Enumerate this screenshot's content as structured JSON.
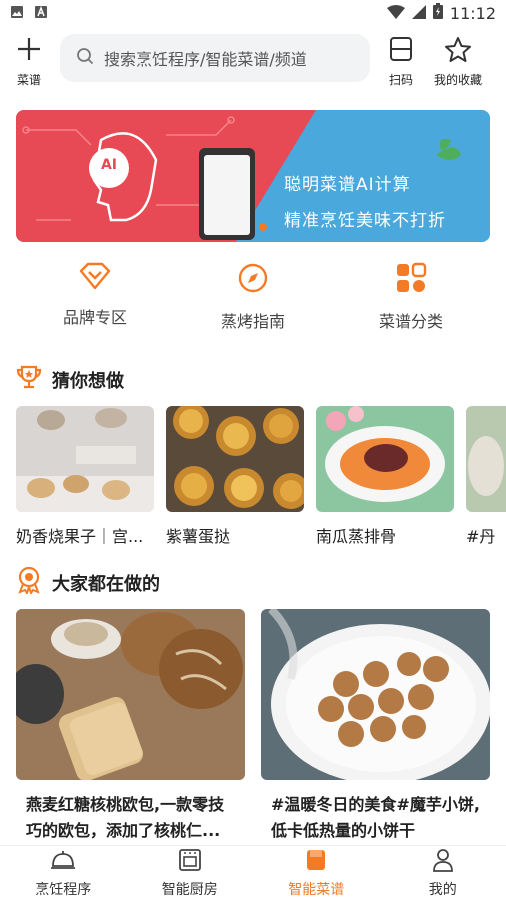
{
  "status": {
    "time": "11:12"
  },
  "topbar": {
    "menu_label": "菜谱",
    "search_placeholder": "搜索烹饪程序/智能菜谱/频道",
    "scan_label": "扫码",
    "favorites_label": "我的收藏"
  },
  "banner": {
    "line1": "聪明菜谱AI计算",
    "line2": "精准烹饪美味不打折",
    "ai_text": "AI"
  },
  "categories": [
    {
      "label": "品牌专区",
      "icon": "diamond-icon"
    },
    {
      "label": "蒸烤指南",
      "icon": "compass-icon"
    },
    {
      "label": "菜谱分类",
      "icon": "grid-icon"
    }
  ],
  "guess": {
    "title": "猜你想做",
    "items": [
      {
        "name": "奶香烧果子｜宫..."
      },
      {
        "name": "紫薯蛋挞"
      },
      {
        "name": "南瓜蒸排骨"
      },
      {
        "name": "#丹"
      }
    ]
  },
  "popular": {
    "title": "大家都在做的",
    "items": [
      {
        "title": "燕麦红糖核桃欧包,一款零技巧的欧包，添加了核桃仁..."
      },
      {
        "title": "#温暖冬日的美食#魔芋小饼,低卡低热量的小饼干"
      }
    ]
  },
  "tabs": [
    {
      "label": "烹饪程序"
    },
    {
      "label": "智能厨房"
    },
    {
      "label": "智能菜谱"
    },
    {
      "label": "我的"
    }
  ],
  "colors": {
    "accent": "#f47b25",
    "banner_red": "#e84a55",
    "banner_blue": "#4aa8dc"
  }
}
